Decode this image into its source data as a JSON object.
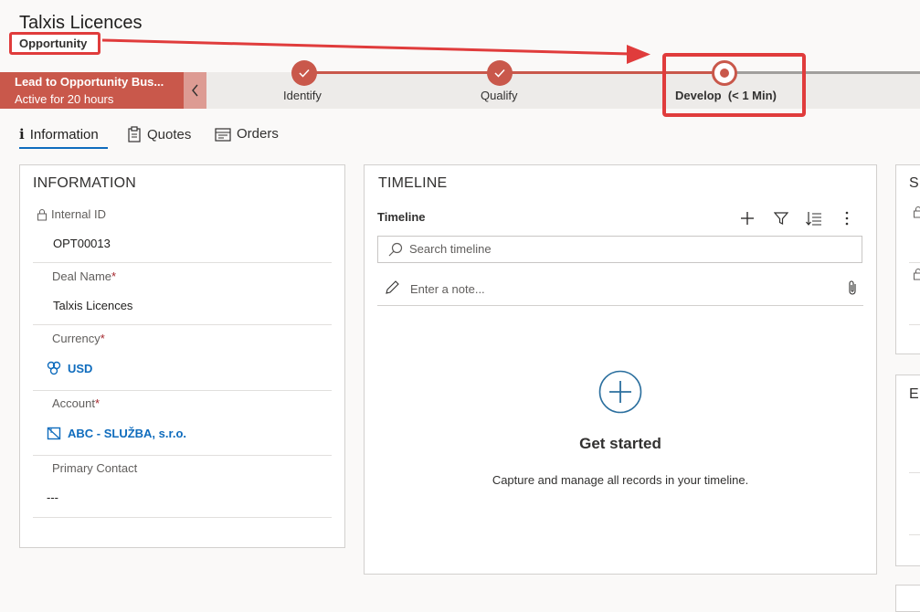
{
  "header": {
    "title": "Talxis Licences",
    "entity": "Opportunity"
  },
  "bpf": {
    "name": "Lead to Opportunity Bus...",
    "active": "Active for 20 hours",
    "stages": [
      {
        "label": "Identify",
        "state": "completed"
      },
      {
        "label": "Qualify",
        "state": "completed"
      },
      {
        "label": "Develop",
        "duration": "(< 1 Min)",
        "state": "active"
      }
    ]
  },
  "tabs": [
    {
      "label": "Information"
    },
    {
      "label": "Quotes"
    },
    {
      "label": "Orders"
    }
  ],
  "information": {
    "title": "INFORMATION",
    "internal_id": {
      "label": "Internal ID",
      "value": "OPT00013"
    },
    "deal_name": {
      "label": "Deal Name",
      "required": "*",
      "value": "Talxis Licences"
    },
    "currency": {
      "label": "Currency",
      "required": "*",
      "value": "USD"
    },
    "account": {
      "label": "Account",
      "required": "*",
      "value": "ABC - SLUŽBA, s.r.o."
    },
    "primary_contact": {
      "label": "Primary Contact",
      "value": "---"
    }
  },
  "timeline": {
    "title": "TIMELINE",
    "subtitle": "Timeline",
    "search_placeholder": "Search timeline",
    "note_placeholder": "Enter a note...",
    "empty_title": "Get started",
    "empty_text": "Capture and manage all records in your timeline."
  },
  "right_cards": {
    "card1_title": "S",
    "card2_title": "E"
  },
  "colors": {
    "accent": "#c9584b",
    "link": "#0f6cbd",
    "annotation": "#e03c3c"
  }
}
